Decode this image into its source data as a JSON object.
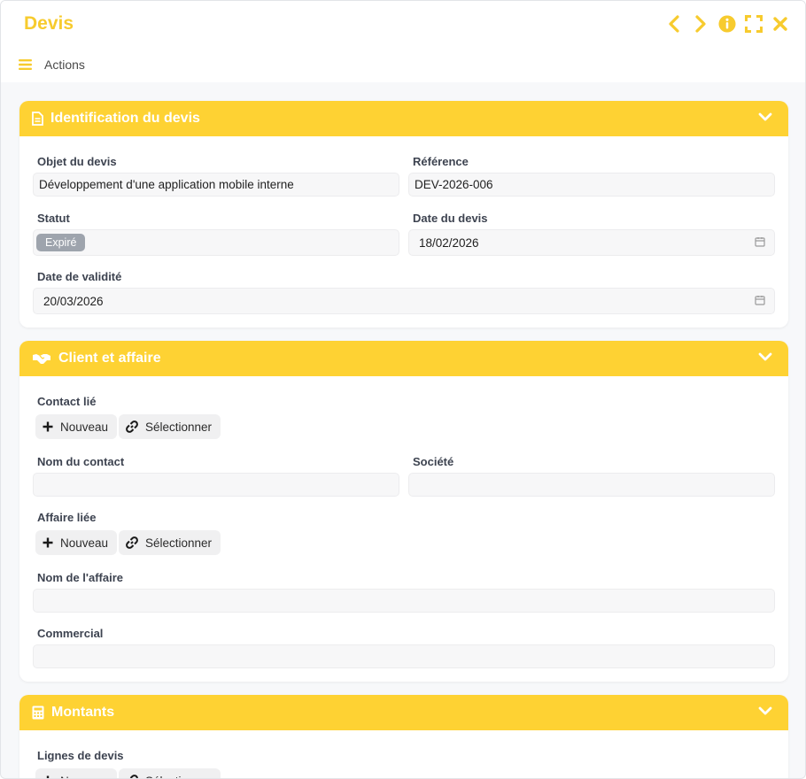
{
  "window": {
    "title": "Devis"
  },
  "toolbar": {
    "actions_label": "Actions"
  },
  "colors": {
    "accent": "#fed233",
    "title": "#f7cb2e",
    "badge": "#9ea4ad"
  },
  "sections": {
    "identification": {
      "title": "Identification du devis",
      "objet_label": "Objet du devis",
      "objet_value": "Développement d'une application mobile interne",
      "reference_label": "Référence",
      "reference_value": "DEV-2026-006",
      "statut_label": "Statut",
      "statut_value": "Expiré",
      "date_label": "Date du devis",
      "date_value": "18/02/2026",
      "validite_label": "Date de validité",
      "validite_value": "20/03/2026"
    },
    "client": {
      "title": "Client et affaire",
      "contact_label": "Contact lié",
      "nom_contact_label": "Nom du contact",
      "societe_label": "Société",
      "affaire_label": "Affaire liée",
      "nom_affaire_label": "Nom de l'affaire",
      "commercial_label": "Commercial"
    },
    "montants": {
      "title": "Montants",
      "lignes_label": "Lignes de devis"
    }
  },
  "buttons": {
    "new_label": "Nouveau",
    "select_label": "Sélectionner"
  }
}
